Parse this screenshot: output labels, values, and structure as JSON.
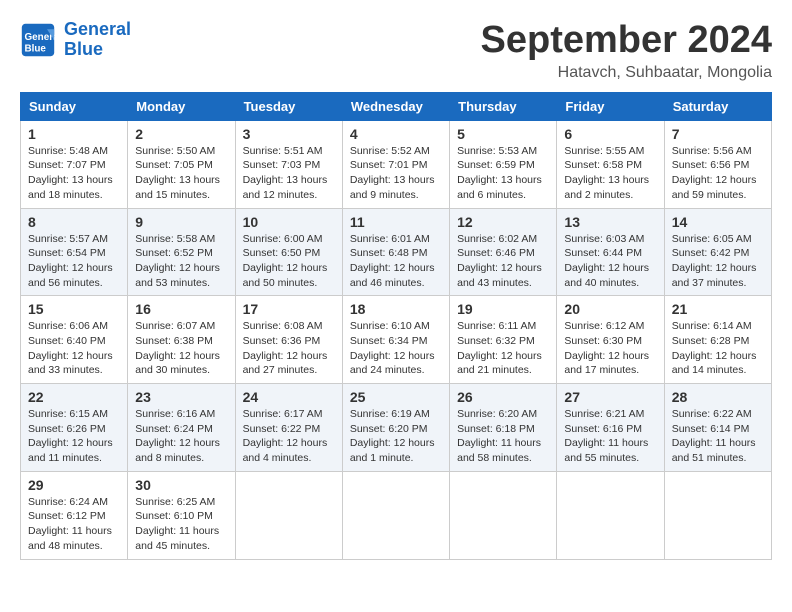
{
  "header": {
    "logo_line1": "General",
    "logo_line2": "Blue",
    "month": "September 2024",
    "location": "Hatavch, Suhbaatar, Mongolia"
  },
  "weekdays": [
    "Sunday",
    "Monday",
    "Tuesday",
    "Wednesday",
    "Thursday",
    "Friday",
    "Saturday"
  ],
  "weeks": [
    [
      {
        "day": "1",
        "info": "Sunrise: 5:48 AM\nSunset: 7:07 PM\nDaylight: 13 hours\nand 18 minutes."
      },
      {
        "day": "2",
        "info": "Sunrise: 5:50 AM\nSunset: 7:05 PM\nDaylight: 13 hours\nand 15 minutes."
      },
      {
        "day": "3",
        "info": "Sunrise: 5:51 AM\nSunset: 7:03 PM\nDaylight: 13 hours\nand 12 minutes."
      },
      {
        "day": "4",
        "info": "Sunrise: 5:52 AM\nSunset: 7:01 PM\nDaylight: 13 hours\nand 9 minutes."
      },
      {
        "day": "5",
        "info": "Sunrise: 5:53 AM\nSunset: 6:59 PM\nDaylight: 13 hours\nand 6 minutes."
      },
      {
        "day": "6",
        "info": "Sunrise: 5:55 AM\nSunset: 6:58 PM\nDaylight: 13 hours\nand 2 minutes."
      },
      {
        "day": "7",
        "info": "Sunrise: 5:56 AM\nSunset: 6:56 PM\nDaylight: 12 hours\nand 59 minutes."
      }
    ],
    [
      {
        "day": "8",
        "info": "Sunrise: 5:57 AM\nSunset: 6:54 PM\nDaylight: 12 hours\nand 56 minutes."
      },
      {
        "day": "9",
        "info": "Sunrise: 5:58 AM\nSunset: 6:52 PM\nDaylight: 12 hours\nand 53 minutes."
      },
      {
        "day": "10",
        "info": "Sunrise: 6:00 AM\nSunset: 6:50 PM\nDaylight: 12 hours\nand 50 minutes."
      },
      {
        "day": "11",
        "info": "Sunrise: 6:01 AM\nSunset: 6:48 PM\nDaylight: 12 hours\nand 46 minutes."
      },
      {
        "day": "12",
        "info": "Sunrise: 6:02 AM\nSunset: 6:46 PM\nDaylight: 12 hours\nand 43 minutes."
      },
      {
        "day": "13",
        "info": "Sunrise: 6:03 AM\nSunset: 6:44 PM\nDaylight: 12 hours\nand 40 minutes."
      },
      {
        "day": "14",
        "info": "Sunrise: 6:05 AM\nSunset: 6:42 PM\nDaylight: 12 hours\nand 37 minutes."
      }
    ],
    [
      {
        "day": "15",
        "info": "Sunrise: 6:06 AM\nSunset: 6:40 PM\nDaylight: 12 hours\nand 33 minutes."
      },
      {
        "day": "16",
        "info": "Sunrise: 6:07 AM\nSunset: 6:38 PM\nDaylight: 12 hours\nand 30 minutes."
      },
      {
        "day": "17",
        "info": "Sunrise: 6:08 AM\nSunset: 6:36 PM\nDaylight: 12 hours\nand 27 minutes."
      },
      {
        "day": "18",
        "info": "Sunrise: 6:10 AM\nSunset: 6:34 PM\nDaylight: 12 hours\nand 24 minutes."
      },
      {
        "day": "19",
        "info": "Sunrise: 6:11 AM\nSunset: 6:32 PM\nDaylight: 12 hours\nand 21 minutes."
      },
      {
        "day": "20",
        "info": "Sunrise: 6:12 AM\nSunset: 6:30 PM\nDaylight: 12 hours\nand 17 minutes."
      },
      {
        "day": "21",
        "info": "Sunrise: 6:14 AM\nSunset: 6:28 PM\nDaylight: 12 hours\nand 14 minutes."
      }
    ],
    [
      {
        "day": "22",
        "info": "Sunrise: 6:15 AM\nSunset: 6:26 PM\nDaylight: 12 hours\nand 11 minutes."
      },
      {
        "day": "23",
        "info": "Sunrise: 6:16 AM\nSunset: 6:24 PM\nDaylight: 12 hours\nand 8 minutes."
      },
      {
        "day": "24",
        "info": "Sunrise: 6:17 AM\nSunset: 6:22 PM\nDaylight: 12 hours\nand 4 minutes."
      },
      {
        "day": "25",
        "info": "Sunrise: 6:19 AM\nSunset: 6:20 PM\nDaylight: 12 hours\nand 1 minute."
      },
      {
        "day": "26",
        "info": "Sunrise: 6:20 AM\nSunset: 6:18 PM\nDaylight: 11 hours\nand 58 minutes."
      },
      {
        "day": "27",
        "info": "Sunrise: 6:21 AM\nSunset: 6:16 PM\nDaylight: 11 hours\nand 55 minutes."
      },
      {
        "day": "28",
        "info": "Sunrise: 6:22 AM\nSunset: 6:14 PM\nDaylight: 11 hours\nand 51 minutes."
      }
    ],
    [
      {
        "day": "29",
        "info": "Sunrise: 6:24 AM\nSunset: 6:12 PM\nDaylight: 11 hours\nand 48 minutes."
      },
      {
        "day": "30",
        "info": "Sunrise: 6:25 AM\nSunset: 6:10 PM\nDaylight: 11 hours\nand 45 minutes."
      },
      {
        "day": "",
        "info": ""
      },
      {
        "day": "",
        "info": ""
      },
      {
        "day": "",
        "info": ""
      },
      {
        "day": "",
        "info": ""
      },
      {
        "day": "",
        "info": ""
      }
    ]
  ]
}
